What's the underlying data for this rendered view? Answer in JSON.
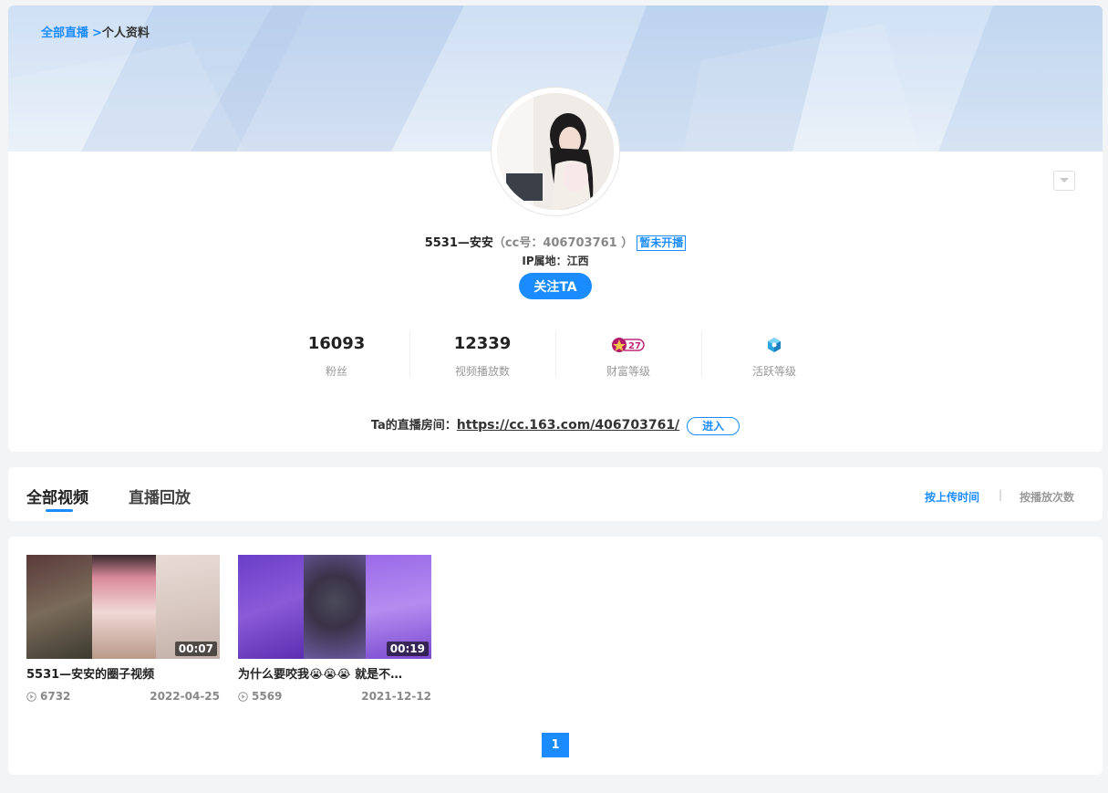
{
  "colors": {
    "accent": "#1a8cff",
    "banner": "#c5daf3"
  },
  "breadcrumb": {
    "root": "全部直播",
    "separator": ">",
    "current": "个人资料"
  },
  "profile": {
    "name": "5531—安安",
    "cc_number": "（cc号：406703761 ）",
    "live_status": "暂未开播",
    "ip_location": "IP属地：江西",
    "follow_label": "关注TA"
  },
  "stats": {
    "fans_value": "16093",
    "fans_label": "粉丝",
    "plays_value": "12339",
    "plays_label": "视频播放数",
    "wealth_level_number": "27",
    "wealth_label": "财富等级",
    "activity_label": "活跃等级"
  },
  "room": {
    "label": "Ta的直播房间：",
    "url": "https://cc.163.com/406703761/",
    "enter_label": "进入"
  },
  "tabs": {
    "all_videos": "全部视频",
    "replays": "直播回放"
  },
  "sort": {
    "by_upload": "按上传时间",
    "divider": "|",
    "by_plays": "按播放次数"
  },
  "videos": [
    {
      "title": "5531—安安的圈子视频",
      "duration": "00:07",
      "plays": "6732",
      "date": "2022-04-25"
    },
    {
      "title": "为什么要咬我😭😭😭 就是不…",
      "duration": "00:19",
      "plays": "5569",
      "date": "2021-12-12"
    }
  ],
  "pagination": {
    "current_page": "1"
  }
}
